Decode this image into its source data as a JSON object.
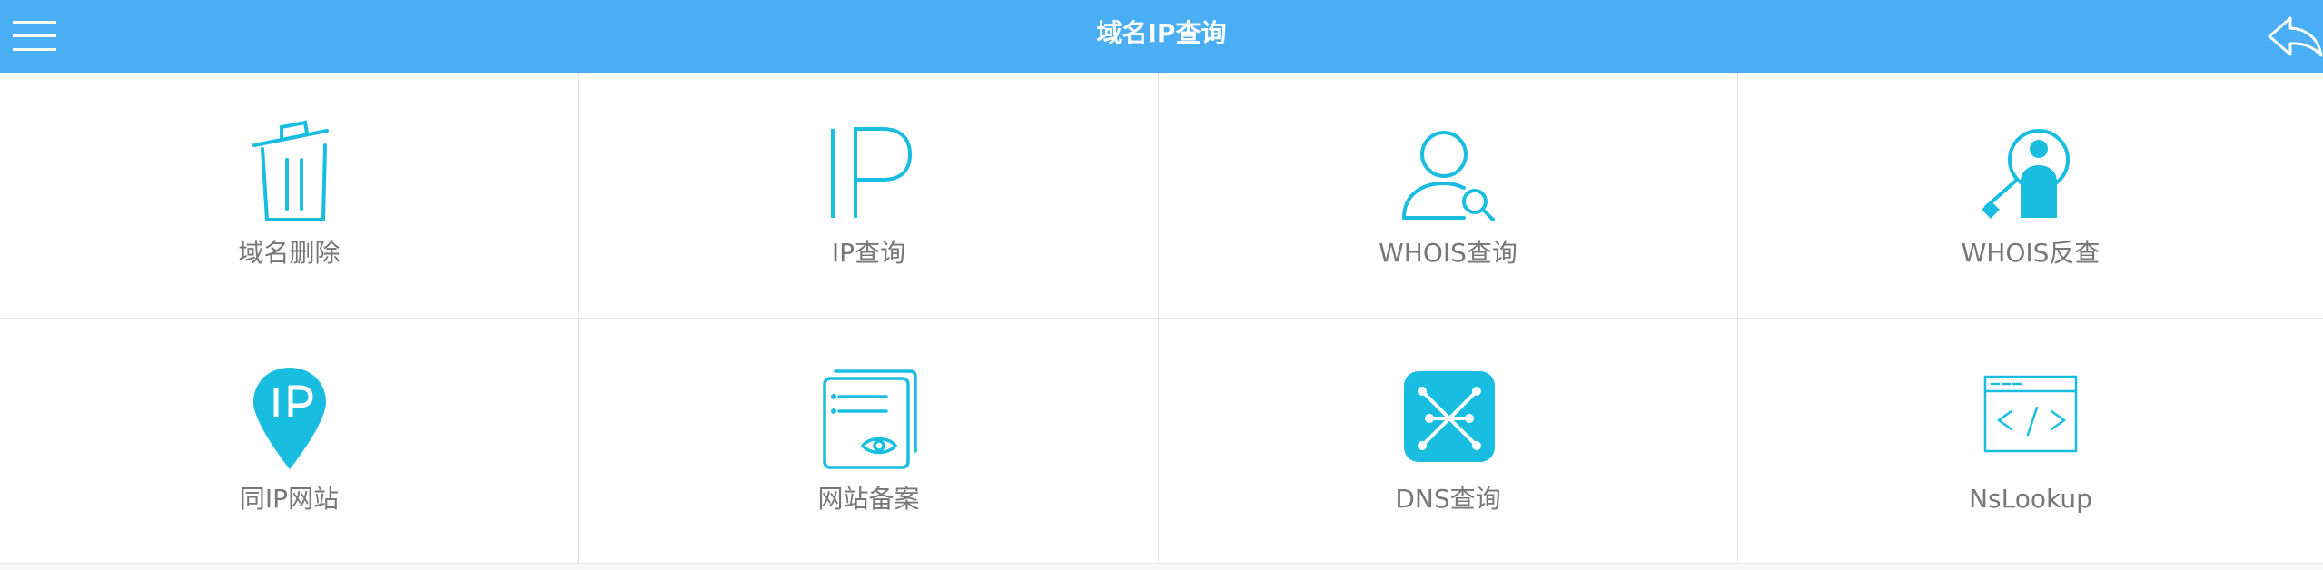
{
  "header": {
    "title": "域名IP查询",
    "menu_icon": "hamburger-menu-icon",
    "back_icon": "back-arrow-icon",
    "background_color": "#4aaef5",
    "title_color": "#ffffff"
  },
  "tiles": [
    {
      "label": "域名删除",
      "icon": "trash-icon"
    },
    {
      "label": "IP查询",
      "icon": "ip-text-icon"
    },
    {
      "label": "WHOIS查询",
      "icon": "user-search-icon"
    },
    {
      "label": "WHOIS反查",
      "icon": "reverse-user-search-icon"
    },
    {
      "label": "同IP网站",
      "icon": "ip-location-pin-icon"
    },
    {
      "label": "网站备案",
      "icon": "document-eye-icon"
    },
    {
      "label": "DNS查询",
      "icon": "network-dns-icon"
    },
    {
      "label": "NsLookup",
      "icon": "code-window-icon"
    }
  ],
  "colors": {
    "icon_accent": "#19bde0",
    "label_text": "#777777",
    "divider": "#e4e4e4"
  }
}
